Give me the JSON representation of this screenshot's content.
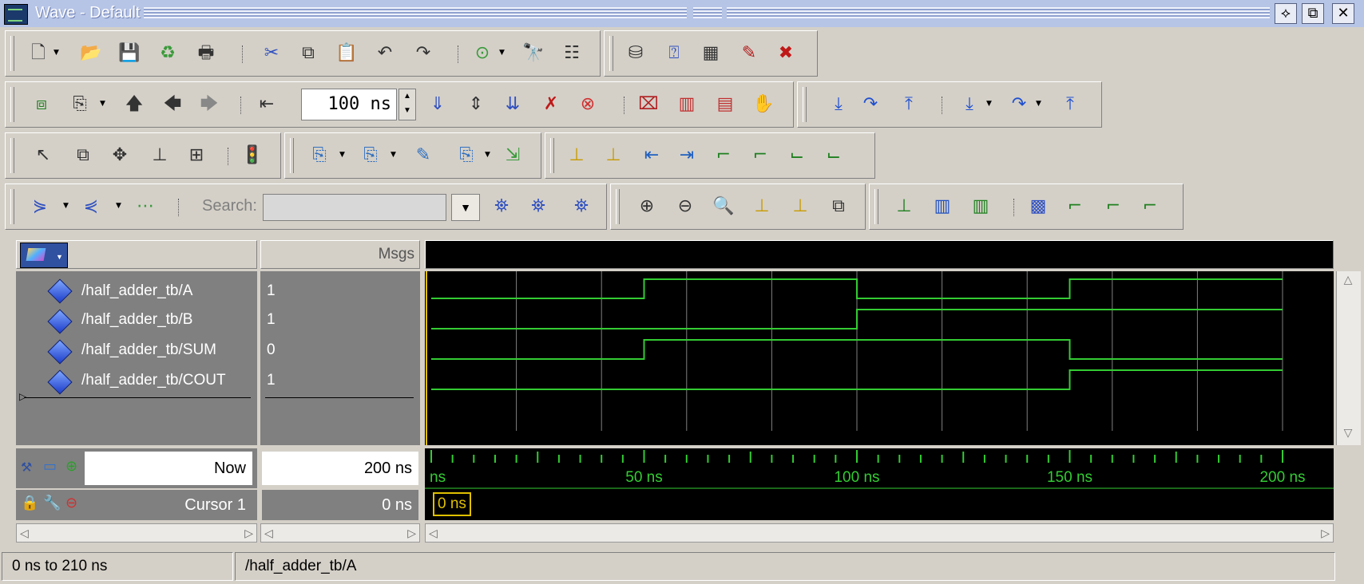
{
  "window": {
    "title": "Wave - Default",
    "buttons": [
      "⟡",
      "⧉",
      "✕"
    ]
  },
  "toolbar": {
    "time_value": "100 ns",
    "search_label": "Search:",
    "search_placeholder": ""
  },
  "wave": {
    "msgs_header": "Msgs",
    "signals": [
      {
        "name": "/half_adder_tb/A",
        "value": "1"
      },
      {
        "name": "/half_adder_tb/B",
        "value": "1"
      },
      {
        "name": "/half_adder_tb/SUM",
        "value": "0"
      },
      {
        "name": "/half_adder_tb/COUT",
        "value": "1"
      }
    ],
    "waveforms": [
      [
        [
          0,
          0
        ],
        [
          50,
          1
        ],
        [
          100,
          0
        ],
        [
          150,
          1
        ],
        [
          200,
          1
        ]
      ],
      [
        [
          0,
          0
        ],
        [
          100,
          1
        ],
        [
          200,
          1
        ]
      ],
      [
        [
          0,
          0
        ],
        [
          50,
          1
        ],
        [
          150,
          0
        ],
        [
          200,
          0
        ]
      ],
      [
        [
          0,
          0
        ],
        [
          150,
          1
        ],
        [
          200,
          1
        ]
      ]
    ],
    "time_range_ns": [
      0,
      200
    ],
    "colors": {
      "wave": "#33cc33",
      "background": "#000000",
      "grid": "#808080",
      "cursor": "#e0c000"
    }
  },
  "cursors": {
    "now_label": "Now",
    "now_value": "200 ns",
    "cursor_label": "Cursor 1",
    "cursor_value": "0 ns",
    "cursor_flag": "0 ns"
  },
  "timeline": {
    "ticks": [
      "ns",
      "50 ns",
      "100 ns",
      "150 ns",
      "200 ns"
    ]
  },
  "status": {
    "range": "0 ns to 210 ns",
    "selected": "/half_adder_tb/A"
  }
}
